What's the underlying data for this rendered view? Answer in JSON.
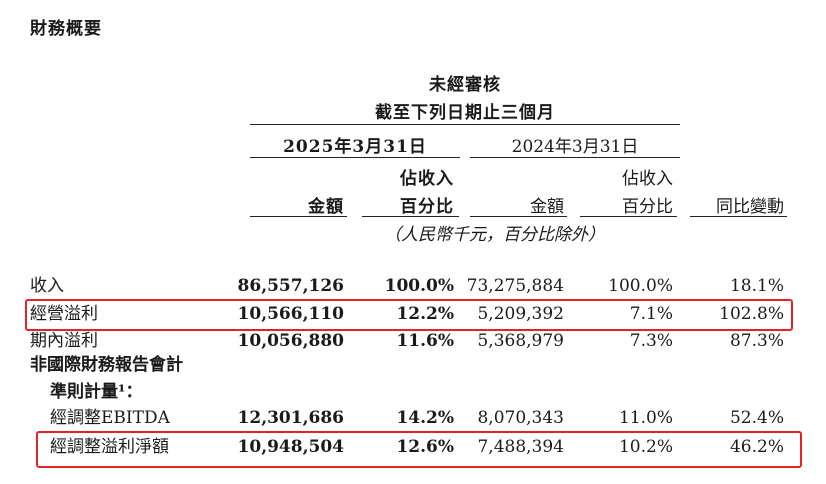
{
  "title": "財務概要",
  "header": {
    "audit": "未經審核",
    "period": "截至下列日期止三個月",
    "date_2025": "2025年3月31日",
    "date_2024": "2024年3月31日",
    "amount": "金額",
    "pct_line1": "佔收入",
    "pct_line2": "百分比",
    "yoy": "同比變動",
    "unit_note": "（人民幣千元，百分比除外）"
  },
  "rows": [
    {
      "label": "收入",
      "v2025": "86,557,126",
      "p2025": "100.0%",
      "v2024": "73,275,884",
      "p2024": "100.0%",
      "yoy": "18.1%"
    },
    {
      "label": "經營溢利",
      "v2025": "10,566,110",
      "p2025": "12.2%",
      "v2024": "5,209,392",
      "p2024": "7.1%",
      "yoy": "102.8%"
    },
    {
      "label": "期內溢利",
      "v2025": "10,056,880",
      "p2025": "11.6%",
      "v2024": "5,368,979",
      "p2024": "7.3%",
      "yoy": "87.3%"
    },
    {
      "label": "非國際財務報告會計",
      "label_line2": "準則計量¹：",
      "v2025": "",
      "p2025": "",
      "v2024": "",
      "p2024": "",
      "yoy": ""
    },
    {
      "label": "經調整EBITDA",
      "v2025": "12,301,686",
      "p2025": "14.2%",
      "v2024": "8,070,343",
      "p2024": "11.0%",
      "yoy": "52.4%"
    },
    {
      "label": "經調整溢利淨額",
      "v2025": "10,948,504",
      "p2025": "12.6%",
      "v2024": "7,488,394",
      "p2024": "10.2%",
      "yoy": "46.2%"
    }
  ],
  "colors": {
    "highlight": "#e12525",
    "text": "#1a1a1a"
  }
}
